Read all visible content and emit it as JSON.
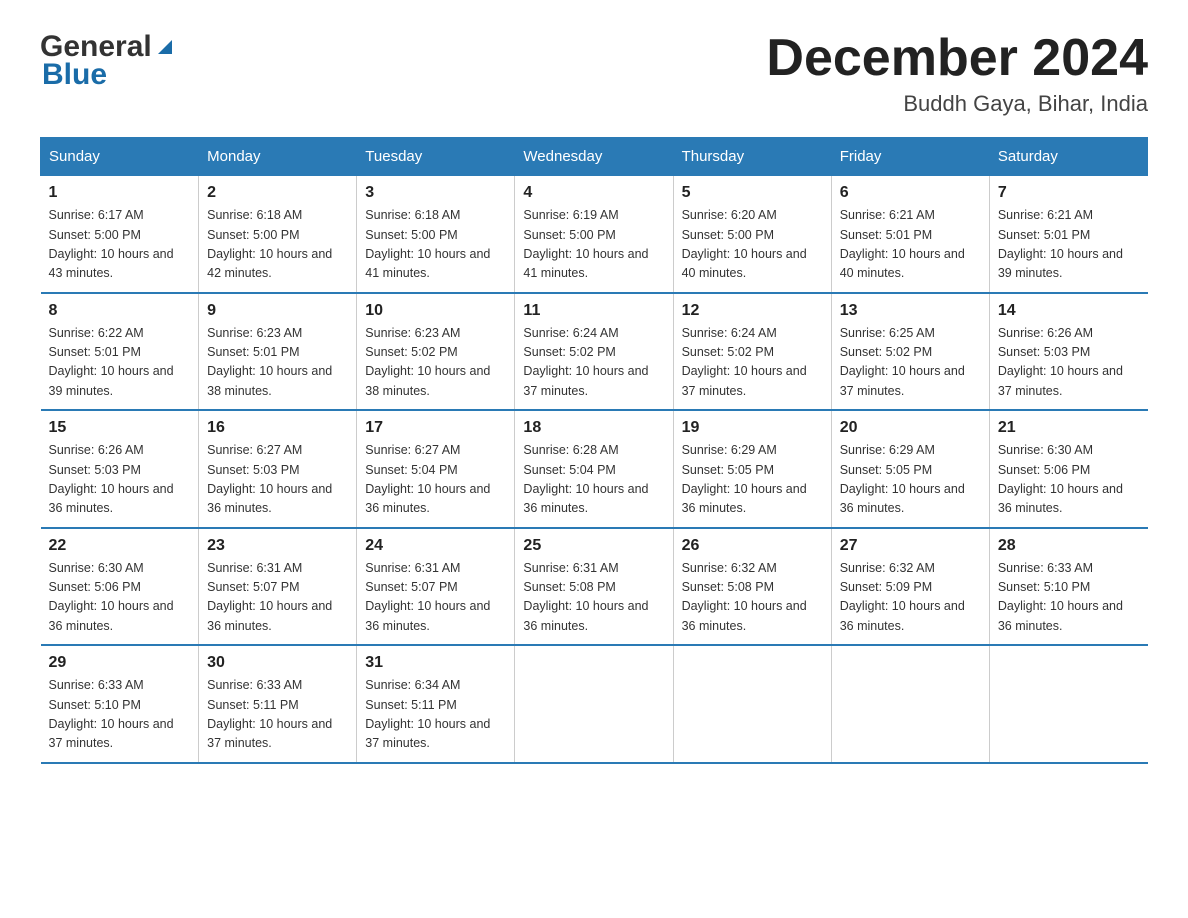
{
  "logo": {
    "text_general": "General",
    "text_blue": "Blue"
  },
  "title": "December 2024",
  "location": "Buddh Gaya, Bihar, India",
  "days_of_week": [
    "Sunday",
    "Monday",
    "Tuesday",
    "Wednesday",
    "Thursday",
    "Friday",
    "Saturday"
  ],
  "weeks": [
    [
      {
        "day": "1",
        "sunrise": "6:17 AM",
        "sunset": "5:00 PM",
        "daylight": "10 hours and 43 minutes."
      },
      {
        "day": "2",
        "sunrise": "6:18 AM",
        "sunset": "5:00 PM",
        "daylight": "10 hours and 42 minutes."
      },
      {
        "day": "3",
        "sunrise": "6:18 AM",
        "sunset": "5:00 PM",
        "daylight": "10 hours and 41 minutes."
      },
      {
        "day": "4",
        "sunrise": "6:19 AM",
        "sunset": "5:00 PM",
        "daylight": "10 hours and 41 minutes."
      },
      {
        "day": "5",
        "sunrise": "6:20 AM",
        "sunset": "5:00 PM",
        "daylight": "10 hours and 40 minutes."
      },
      {
        "day": "6",
        "sunrise": "6:21 AM",
        "sunset": "5:01 PM",
        "daylight": "10 hours and 40 minutes."
      },
      {
        "day": "7",
        "sunrise": "6:21 AM",
        "sunset": "5:01 PM",
        "daylight": "10 hours and 39 minutes."
      }
    ],
    [
      {
        "day": "8",
        "sunrise": "6:22 AM",
        "sunset": "5:01 PM",
        "daylight": "10 hours and 39 minutes."
      },
      {
        "day": "9",
        "sunrise": "6:23 AM",
        "sunset": "5:01 PM",
        "daylight": "10 hours and 38 minutes."
      },
      {
        "day": "10",
        "sunrise": "6:23 AM",
        "sunset": "5:02 PM",
        "daylight": "10 hours and 38 minutes."
      },
      {
        "day": "11",
        "sunrise": "6:24 AM",
        "sunset": "5:02 PM",
        "daylight": "10 hours and 37 minutes."
      },
      {
        "day": "12",
        "sunrise": "6:24 AM",
        "sunset": "5:02 PM",
        "daylight": "10 hours and 37 minutes."
      },
      {
        "day": "13",
        "sunrise": "6:25 AM",
        "sunset": "5:02 PM",
        "daylight": "10 hours and 37 minutes."
      },
      {
        "day": "14",
        "sunrise": "6:26 AM",
        "sunset": "5:03 PM",
        "daylight": "10 hours and 37 minutes."
      }
    ],
    [
      {
        "day": "15",
        "sunrise": "6:26 AM",
        "sunset": "5:03 PM",
        "daylight": "10 hours and 36 minutes."
      },
      {
        "day": "16",
        "sunrise": "6:27 AM",
        "sunset": "5:03 PM",
        "daylight": "10 hours and 36 minutes."
      },
      {
        "day": "17",
        "sunrise": "6:27 AM",
        "sunset": "5:04 PM",
        "daylight": "10 hours and 36 minutes."
      },
      {
        "day": "18",
        "sunrise": "6:28 AM",
        "sunset": "5:04 PM",
        "daylight": "10 hours and 36 minutes."
      },
      {
        "day": "19",
        "sunrise": "6:29 AM",
        "sunset": "5:05 PM",
        "daylight": "10 hours and 36 minutes."
      },
      {
        "day": "20",
        "sunrise": "6:29 AM",
        "sunset": "5:05 PM",
        "daylight": "10 hours and 36 minutes."
      },
      {
        "day": "21",
        "sunrise": "6:30 AM",
        "sunset": "5:06 PM",
        "daylight": "10 hours and 36 minutes."
      }
    ],
    [
      {
        "day": "22",
        "sunrise": "6:30 AM",
        "sunset": "5:06 PM",
        "daylight": "10 hours and 36 minutes."
      },
      {
        "day": "23",
        "sunrise": "6:31 AM",
        "sunset": "5:07 PM",
        "daylight": "10 hours and 36 minutes."
      },
      {
        "day": "24",
        "sunrise": "6:31 AM",
        "sunset": "5:07 PM",
        "daylight": "10 hours and 36 minutes."
      },
      {
        "day": "25",
        "sunrise": "6:31 AM",
        "sunset": "5:08 PM",
        "daylight": "10 hours and 36 minutes."
      },
      {
        "day": "26",
        "sunrise": "6:32 AM",
        "sunset": "5:08 PM",
        "daylight": "10 hours and 36 minutes."
      },
      {
        "day": "27",
        "sunrise": "6:32 AM",
        "sunset": "5:09 PM",
        "daylight": "10 hours and 36 minutes."
      },
      {
        "day": "28",
        "sunrise": "6:33 AM",
        "sunset": "5:10 PM",
        "daylight": "10 hours and 36 minutes."
      }
    ],
    [
      {
        "day": "29",
        "sunrise": "6:33 AM",
        "sunset": "5:10 PM",
        "daylight": "10 hours and 37 minutes."
      },
      {
        "day": "30",
        "sunrise": "6:33 AM",
        "sunset": "5:11 PM",
        "daylight": "10 hours and 37 minutes."
      },
      {
        "day": "31",
        "sunrise": "6:34 AM",
        "sunset": "5:11 PM",
        "daylight": "10 hours and 37 minutes."
      },
      null,
      null,
      null,
      null
    ]
  ],
  "colors": {
    "header_bg": "#2a7ab5",
    "header_text": "#ffffff",
    "accent": "#1a6ca8"
  }
}
